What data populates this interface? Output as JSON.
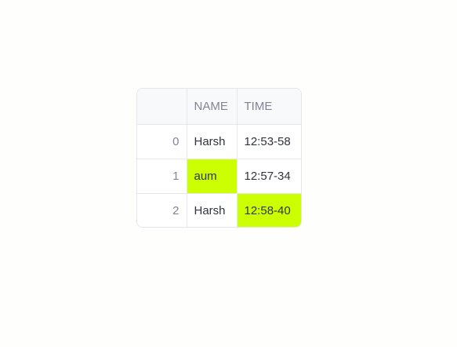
{
  "colors": {
    "page_background": "#fefefc",
    "header_background": "#f8f9fb",
    "header_text": "#808495",
    "cell_text": "#31333f",
    "border": "#e6e8ec",
    "highlight": "#ccff00"
  },
  "table": {
    "columns": [
      "",
      "NAME",
      "TIME"
    ],
    "rows": [
      {
        "index": "0",
        "name": "Harsh",
        "time": "12:53-58",
        "highlight_name": false,
        "highlight_time": false
      },
      {
        "index": "1",
        "name": "aum",
        "time": "12:57-34",
        "highlight_name": true,
        "highlight_time": false
      },
      {
        "index": "2",
        "name": "Harsh",
        "time": "12:58-40",
        "highlight_name": false,
        "highlight_time": true
      }
    ]
  }
}
